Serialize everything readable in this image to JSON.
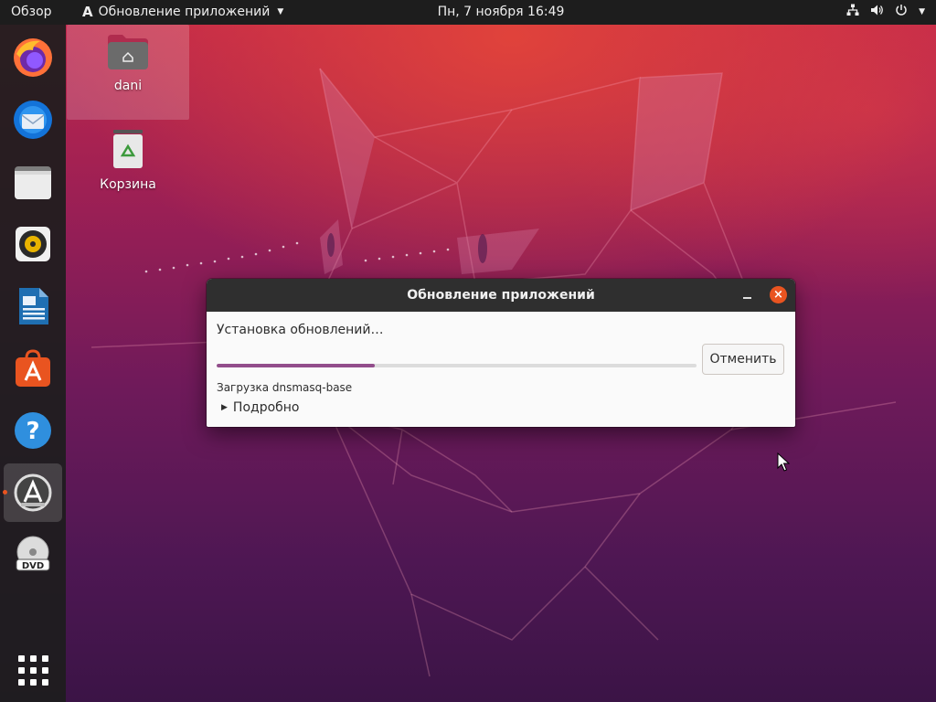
{
  "topbar": {
    "activities": "Обзор",
    "app_menu_icon": "software-updater-icon",
    "app_menu_label": "Обновление приложений",
    "clock": "Пн, 7 ноября  16:49",
    "tray_icons": [
      "network-icon",
      "volume-icon",
      "power-icon",
      "chevron-down-icon"
    ]
  },
  "dock": {
    "items": [
      {
        "name": "firefox-icon"
      },
      {
        "name": "thunderbird-icon"
      },
      {
        "name": "files-icon"
      },
      {
        "name": "rhythmbox-icon"
      },
      {
        "name": "libreoffice-writer-icon"
      },
      {
        "name": "software-center-icon"
      },
      {
        "name": "help-icon"
      },
      {
        "name": "software-updater-icon",
        "active": true
      },
      {
        "name": "dvd-icon"
      }
    ],
    "show_apps": "show-apps-icon"
  },
  "desktop": {
    "icons": [
      {
        "label": "dani",
        "icon": "home-folder-icon"
      },
      {
        "label": "Корзина",
        "icon": "trash-icon"
      }
    ]
  },
  "dialog": {
    "title": "Обновление приложений",
    "status": "Установка обновлений…",
    "progress": 0.33,
    "cancel_label": "Отменить",
    "substatus": "Загрузка dnsmasq-base",
    "details_label": "Подробно"
  },
  "colors": {
    "accent": "#e95420",
    "progress": "#924d8b",
    "topbar": "#1d1d1d",
    "titlebar": "#2f2f2f"
  }
}
